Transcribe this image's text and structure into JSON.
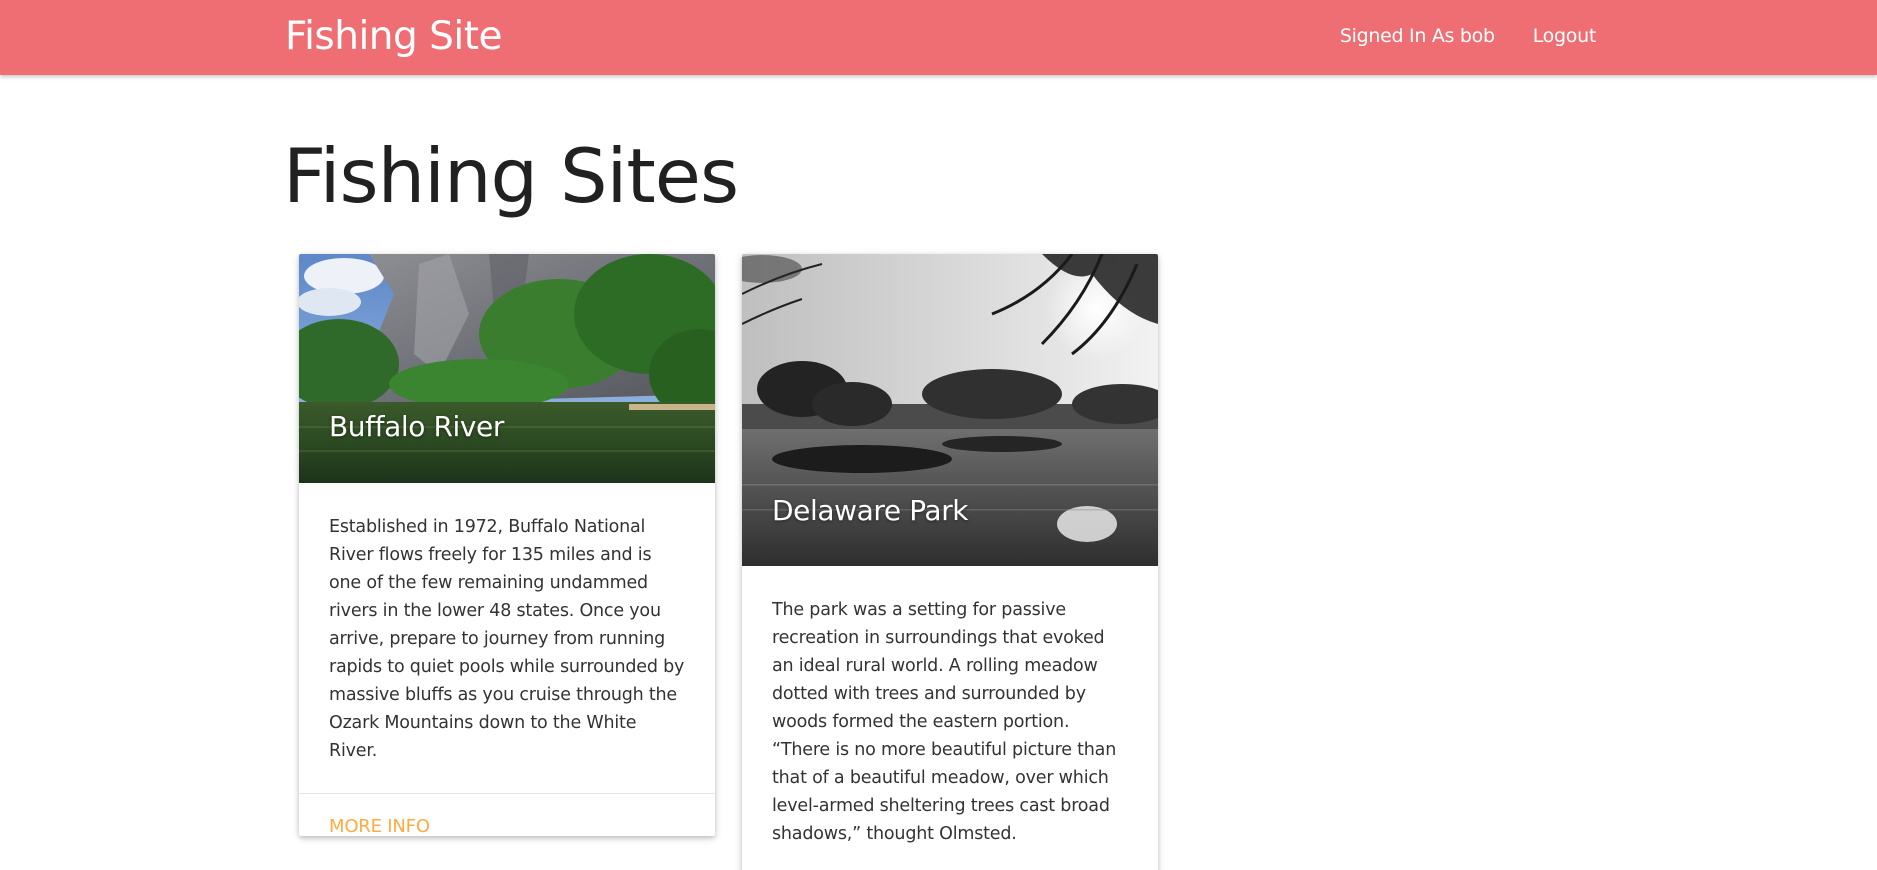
{
  "navbar": {
    "brand": "Fishing Site",
    "links": [
      {
        "label": "Signed In As bob"
      },
      {
        "label": "Logout"
      }
    ],
    "color": "#ef6e74"
  },
  "page": {
    "title": "Fishing Sites"
  },
  "cards": [
    {
      "title": "Buffalo River",
      "description": "Established in 1972, Buffalo National River flows freely for 135 miles and is one of the few remaining undammed rivers in the lower 48 states. Once you arrive, prepare to journey from running rapids to quiet pools while surrounded by massive bluffs as you cruise through the Ozark Mountains down to the White River.",
      "action": "MORE INFO"
    },
    {
      "title": "Delaware Park",
      "description": "The park was a setting for passive recreation in surroundings that evoked an ideal rural world. A rolling meadow dotted with trees and surrounded by woods formed the eastern portion. “There is no more beautiful picture than that of a beautiful meadow, over which level-armed sheltering trees cast broad shadows,” thought Olmsted."
    }
  ],
  "colors": {
    "accent": "#ffab40"
  }
}
